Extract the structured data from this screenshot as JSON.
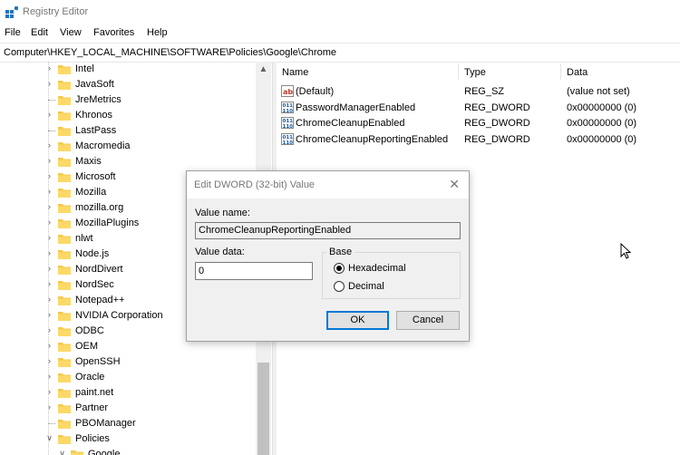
{
  "window": {
    "title": "Registry Editor"
  },
  "menu": [
    "File",
    "Edit",
    "View",
    "Favorites",
    "Help"
  ],
  "address": "Computer\\HKEY_LOCAL_MACHINE\\SOFTWARE\\Policies\\Google\\Chrome",
  "tree": [
    {
      "label": "Intel",
      "expandable": true
    },
    {
      "label": "JavaSoft",
      "expandable": true
    },
    {
      "label": "JreMetrics",
      "expandable": false
    },
    {
      "label": "Khronos",
      "expandable": true
    },
    {
      "label": "LastPass",
      "expandable": false
    },
    {
      "label": "Macromedia",
      "expandable": true
    },
    {
      "label": "Maxis",
      "expandable": true
    },
    {
      "label": "Microsoft",
      "expandable": true
    },
    {
      "label": "Mozilla",
      "expandable": true
    },
    {
      "label": "mozilla.org",
      "expandable": true
    },
    {
      "label": "MozillaPlugins",
      "expandable": true
    },
    {
      "label": "nlwt",
      "expandable": true
    },
    {
      "label": "Node.js",
      "expandable": true
    },
    {
      "label": "NordDivert",
      "expandable": true
    },
    {
      "label": "NordSec",
      "expandable": true
    },
    {
      "label": "Notepad++",
      "expandable": true
    },
    {
      "label": "NVIDIA Corporation",
      "expandable": true
    },
    {
      "label": "ODBC",
      "expandable": true
    },
    {
      "label": "OEM",
      "expandable": true
    },
    {
      "label": "OpenSSH",
      "expandable": true
    },
    {
      "label": "Oracle",
      "expandable": true
    },
    {
      "label": "paint.net",
      "expandable": true
    },
    {
      "label": "Partner",
      "expandable": true
    },
    {
      "label": "PBOManager",
      "expandable": false
    },
    {
      "label": "Policies",
      "expandable": true,
      "expanded": true
    },
    {
      "label": "Google",
      "expandable": true,
      "expanded": true,
      "child": true
    }
  ],
  "columns": {
    "name": "Name",
    "type": "Type",
    "data": "Data"
  },
  "values": [
    {
      "name": "(Default)",
      "type": "REG_SZ",
      "data": "(value not set)",
      "icon": "string-value-icon"
    },
    {
      "name": "PasswordManagerEnabled",
      "type": "REG_DWORD",
      "data": "0x00000000 (0)",
      "icon": "dword-value-icon"
    },
    {
      "name": "ChromeCleanupEnabled",
      "type": "REG_DWORD",
      "data": "0x00000000 (0)",
      "icon": "dword-value-icon"
    },
    {
      "name": "ChromeCleanupReportingEnabled",
      "type": "REG_DWORD",
      "data": "0x00000000 (0)",
      "icon": "dword-value-icon"
    }
  ],
  "dialog": {
    "title": "Edit DWORD (32-bit) Value",
    "value_name_label": "Value name:",
    "value_name": "ChromeCleanupReportingEnabled",
    "value_data_label": "Value data:",
    "value_data": "0",
    "base_label": "Base",
    "hex_label": "Hexadecimal",
    "dec_label": "Decimal",
    "base_selected": "Hexadecimal",
    "ok": "OK",
    "cancel": "Cancel"
  }
}
